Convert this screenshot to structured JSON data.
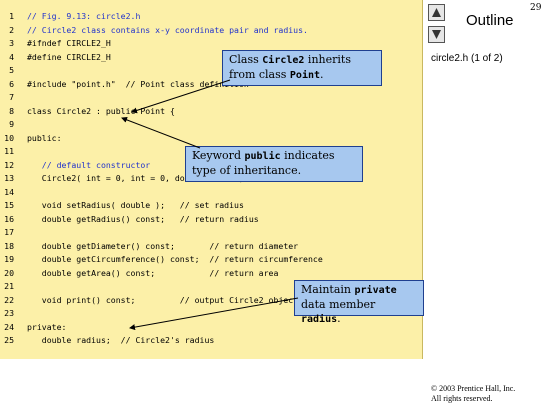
{
  "code": {
    "lines": [
      {
        "num": "1",
        "text": "// Fig. 9.13: circle2.h"
      },
      {
        "num": "2",
        "text": "// Circle2 class contains x-y coordinate pair and radius."
      },
      {
        "num": "3",
        "text": "#ifndef CIRCLE2_H"
      },
      {
        "num": "4",
        "text": "#define CIRCLE2_H"
      },
      {
        "num": "5",
        "text": ""
      },
      {
        "num": "6",
        "text": "#include \"point.h\"  // Point class definition"
      },
      {
        "num": "7",
        "text": ""
      },
      {
        "num": "8",
        "text": "class Circle2 : public Point {"
      },
      {
        "num": "9",
        "text": ""
      },
      {
        "num": "10",
        "text": "public:"
      },
      {
        "num": "11",
        "text": ""
      },
      {
        "num": "12",
        "text": "   // default constructor"
      },
      {
        "num": "13",
        "text": "   Circle2( int = 0, int = 0, double = 0.0 );"
      },
      {
        "num": "14",
        "text": ""
      },
      {
        "num": "15",
        "text": "   void setRadius( double );   // set radius"
      },
      {
        "num": "16",
        "text": "   double getRadius() const;   // return radius"
      },
      {
        "num": "17",
        "text": ""
      },
      {
        "num": "18",
        "text": "   double getDiameter() const;       // return diameter"
      },
      {
        "num": "19",
        "text": "   double getCircumference() const;  // return circumference"
      },
      {
        "num": "20",
        "text": "   double getArea() const;           // return area"
      },
      {
        "num": "21",
        "text": ""
      },
      {
        "num": "22",
        "text": "   void print() const;         // output Circle2 object"
      },
      {
        "num": "23",
        "text": ""
      },
      {
        "num": "24",
        "text": "private:"
      },
      {
        "num": "25",
        "text": "   double radius;  // Circle2's radius"
      }
    ]
  },
  "callouts": {
    "inherit": {
      "pre": "Class ",
      "code1": "Circle2",
      "mid": " inherits from class ",
      "code2": "Point",
      "post": "."
    },
    "keyword": {
      "pre": "Keyword ",
      "code1": "public",
      "post": " indicates type of inheritance."
    },
    "private": {
      "pre": "Maintain ",
      "code1": "private",
      "mid": " data member ",
      "code2": "radius",
      "post": "."
    }
  },
  "sidebar": {
    "page_number": "29",
    "outline_label": "Outline",
    "file_label": "circle2.h (1 of 2)",
    "copyright_line1": "© 2003 Prentice Hall, Inc.",
    "copyright_line2": "All rights reserved."
  },
  "colors": {
    "code_background": "#fcf0a8",
    "callout_background": "#a7c8ef",
    "comment_color": "#2233cc"
  },
  "icons": {
    "nav_up": "triangle-up-icon",
    "nav_down": "triangle-down-icon"
  }
}
